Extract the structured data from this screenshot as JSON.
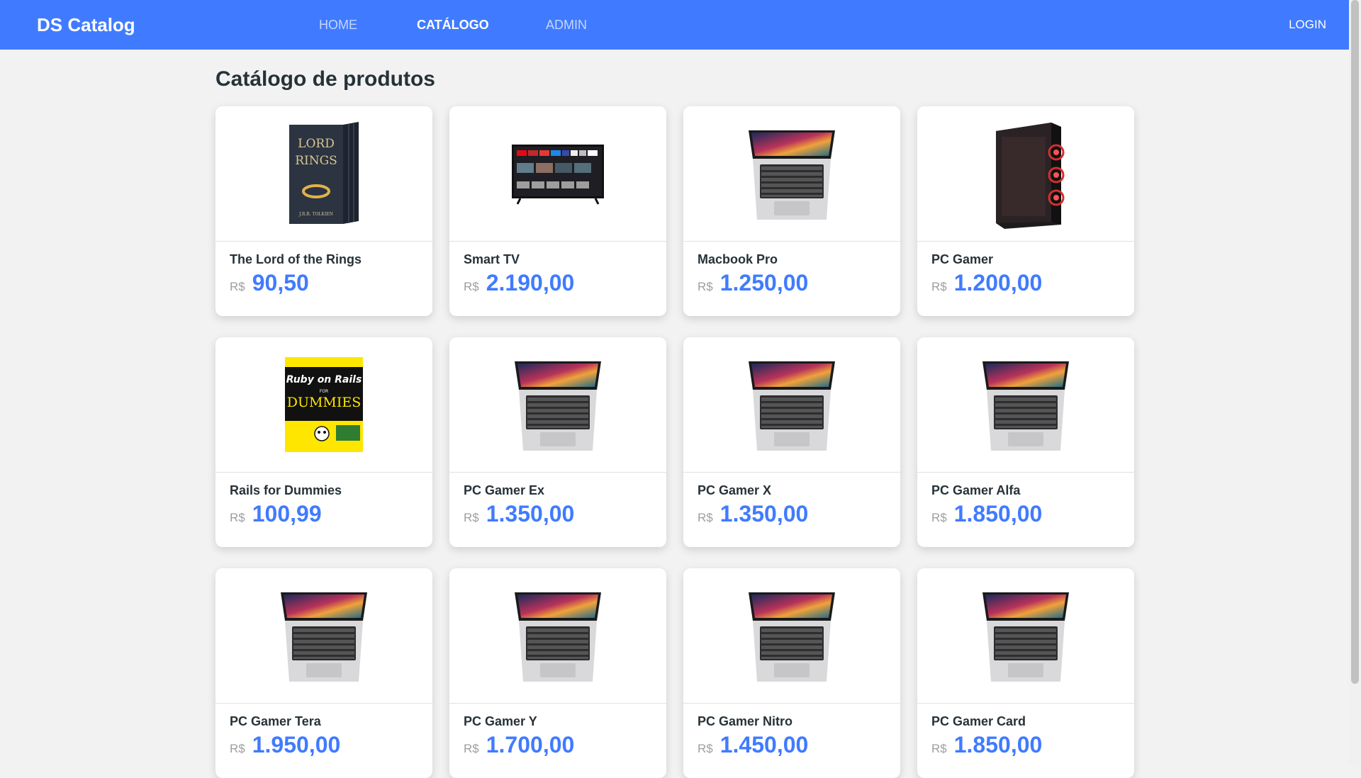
{
  "header": {
    "brand": "DS Catalog",
    "nav": [
      "HOME",
      "CATÁLOGO",
      "ADMIN"
    ],
    "login": "LOGIN"
  },
  "page": {
    "title": "Catálogo de produtos"
  },
  "colors": {
    "primary": "#407bff",
    "background": "#f2f2f2",
    "text": "#263238",
    "muted": "#9e9e9e"
  },
  "products": [
    {
      "name": "The Lord of the Rings",
      "currency": "R$",
      "price": "90,50",
      "image": "book-lotr"
    },
    {
      "name": "Smart TV",
      "currency": "R$",
      "price": "2.190,00",
      "image": "tv"
    },
    {
      "name": "Macbook Pro",
      "currency": "R$",
      "price": "1.250,00",
      "image": "laptop"
    },
    {
      "name": "PC Gamer",
      "currency": "R$",
      "price": "1.200,00",
      "image": "pc-case"
    },
    {
      "name": "Rails for Dummies",
      "currency": "R$",
      "price": "100,99",
      "image": "book-dummies"
    },
    {
      "name": "PC Gamer Ex",
      "currency": "R$",
      "price": "1.350,00",
      "image": "laptop"
    },
    {
      "name": "PC Gamer X",
      "currency": "R$",
      "price": "1.350,00",
      "image": "laptop"
    },
    {
      "name": "PC Gamer Alfa",
      "currency": "R$",
      "price": "1.850,00",
      "image": "laptop"
    },
    {
      "name": "PC Gamer Tera",
      "currency": "R$",
      "price": "1.950,00",
      "image": "laptop"
    },
    {
      "name": "PC Gamer Y",
      "currency": "R$",
      "price": "1.700,00",
      "image": "laptop"
    },
    {
      "name": "PC Gamer Nitro",
      "currency": "R$",
      "price": "1.450,00",
      "image": "laptop"
    },
    {
      "name": "PC Gamer Card",
      "currency": "R$",
      "price": "1.850,00",
      "image": "laptop"
    }
  ],
  "book_covers": {
    "lotr": {
      "line1": "LORD",
      "line2": "RINGS",
      "author": "J.R.R. TOLKIEN"
    },
    "dummies": {
      "title": "Ruby on Rails",
      "for": "FOR",
      "brand": "DUMMIES"
    }
  }
}
